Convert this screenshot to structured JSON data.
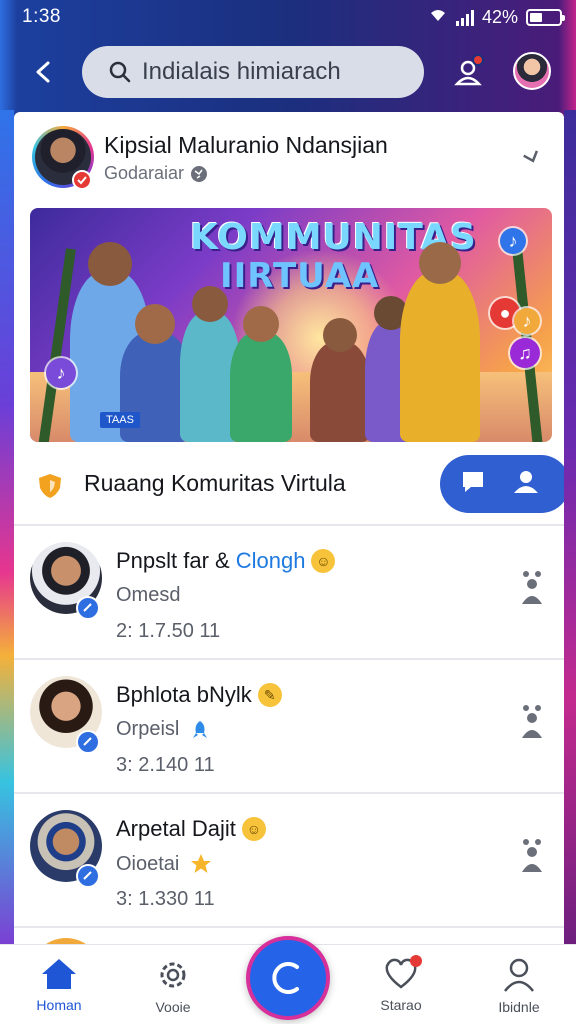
{
  "status_bar": {
    "time": "1:38",
    "battery_text": "42%",
    "battery_level": 0.42
  },
  "top_bar": {
    "back_icon": "arrow-left-icon",
    "search_value": "Indialais himiarach",
    "notification_icon": "user-alert-icon",
    "profile_icon": "avatar"
  },
  "profile": {
    "name": "Kipsial Maluranio Ndansjian",
    "subtitle": "Godaraiar"
  },
  "banner": {
    "title_line1": "KOMMUNITAS",
    "title_line2": "IIRTUAA",
    "sign": "TAAS"
  },
  "group": {
    "title": "Ruaang Komuritas Virtula",
    "actions": [
      "chat-icon",
      "person-icon"
    ]
  },
  "members": [
    {
      "name": "Pnpslt far &",
      "name_accent": "Clongh",
      "emoji": "☺",
      "status": "Omesd",
      "status_icon": "",
      "stat": "2: 1.7.50  11"
    },
    {
      "name": "Bphlota bNylk",
      "name_accent": "",
      "emoji": "✎",
      "status": "Orpeisl",
      "status_icon": "rocket-icon",
      "stat": "3: 2.140  11"
    },
    {
      "name": "Arpetal Dajit",
      "name_accent": "",
      "emoji": "☺",
      "status": "Oioetai",
      "status_icon": "star-icon",
      "stat": "3: 1.330  11"
    }
  ],
  "bottom_nav": {
    "items": [
      {
        "label": "Homan",
        "icon": "home-icon",
        "active": true
      },
      {
        "label": "Vooie",
        "icon": "gear-icon",
        "active": false
      },
      {
        "label": "Starao",
        "icon": "heart-icon",
        "active": false
      },
      {
        "label": "Ibidnle",
        "icon": "person-icon",
        "active": false
      }
    ],
    "fab_icon": "refresh-icon"
  },
  "colors": {
    "accent": "#2563e8",
    "badge": "#e53935",
    "header_bg": "#1b2f7e"
  }
}
